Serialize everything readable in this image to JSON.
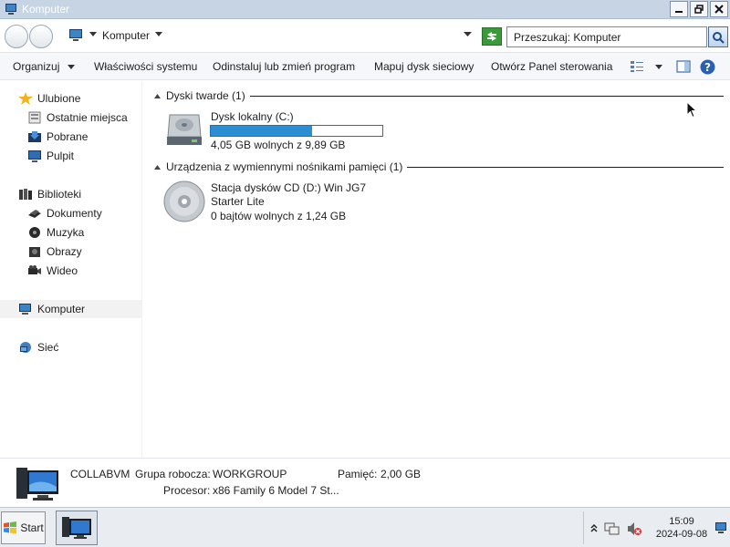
{
  "window": {
    "title": "Komputer"
  },
  "address": {
    "location": "Komputer",
    "search_placeholder": "Przeszukaj: Komputer"
  },
  "toolbar": {
    "organize": "Organizuj",
    "system_properties": "Właściwości systemu",
    "uninstall": "Odinstaluj lub zmień program",
    "map_drive": "Mapuj dysk sieciowy",
    "control_panel": "Otwórz Panel sterowania"
  },
  "sidebar": {
    "favorites": {
      "label": "Ulubione",
      "items": [
        {
          "label": "Ostatnie miejsca",
          "icon": "recent-places-icon"
        },
        {
          "label": "Pobrane",
          "icon": "downloads-icon"
        },
        {
          "label": "Pulpit",
          "icon": "desktop-icon"
        }
      ]
    },
    "libraries": {
      "label": "Biblioteki",
      "items": [
        {
          "label": "Dokumenty",
          "icon": "documents-icon"
        },
        {
          "label": "Muzyka",
          "icon": "music-icon"
        },
        {
          "label": "Obrazy",
          "icon": "pictures-icon"
        },
        {
          "label": "Wideo",
          "icon": "video-icon"
        }
      ]
    },
    "computer": {
      "label": "Komputer"
    },
    "network": {
      "label": "Sieć"
    }
  },
  "content": {
    "hard_disks": {
      "header": "Dyski twarde (1)",
      "drives": [
        {
          "name": "Dysk lokalny (C:)",
          "free_text": "4,05 GB wolnych z 9,89 GB",
          "used_fraction": 0.59
        }
      ]
    },
    "removable": {
      "header": "Urządzenia z wymiennymi nośnikami pamięci (1)",
      "drives": [
        {
          "name_line1": "Stacja dysków CD (D:) Win JG7",
          "name_line2": "Starter Lite",
          "free_text": "0 bajtów wolnych z 1,24 GB"
        }
      ]
    }
  },
  "details": {
    "computer_name": "COLLABVM",
    "workgroup_label": "Grupa robocza:",
    "workgroup_value": "WORKGROUP",
    "memory_label": "Pamięć:",
    "memory_value": "2,00 GB",
    "processor_label": "Procesor:",
    "processor_value": "x86 Family 6 Model 7 St..."
  },
  "taskbar": {
    "start_label": "Start",
    "time": "15:09",
    "date": "2024-09-08"
  },
  "colors": {
    "accent": "#2b8ed3",
    "titlebar": "#c6d4e4",
    "refresh": "#3a9a3a"
  }
}
